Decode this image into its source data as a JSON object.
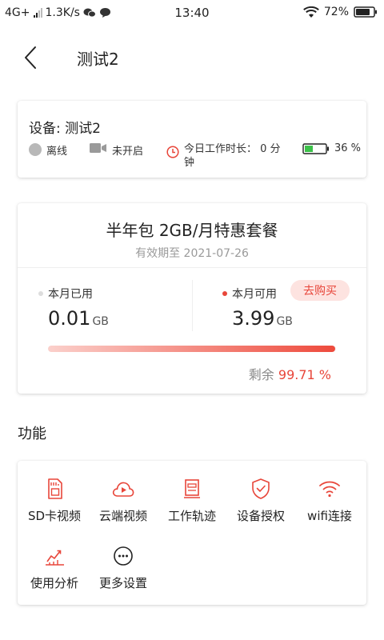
{
  "status_bar": {
    "network": "4G+",
    "speed": "1.3K/s",
    "time": "13:40",
    "battery": "72%"
  },
  "header": {
    "title": "测试2"
  },
  "device": {
    "name": "设备: 测试2",
    "status": "离线",
    "camera": "未开启",
    "work_time": "今日工作时长： 0 分钟",
    "battery": "36 %"
  },
  "plan": {
    "title": "半年包 2GB/月特惠套餐",
    "expiry": "有效期至 2021-07-26",
    "used_label": "本月已用",
    "used_value": "0.01",
    "used_unit": "GB",
    "avail_label": "本月可用",
    "avail_value": "3.99",
    "avail_unit": "GB",
    "buy_label": "去购买",
    "remaining_label": "剩余",
    "remaining_value": "99.71 %",
    "remaining_fraction": 0.9971
  },
  "features_title": "功能",
  "features": [
    {
      "label": "SD卡视频",
      "icon": "sd-card-icon"
    },
    {
      "label": "云端视频",
      "icon": "cloud-video-icon"
    },
    {
      "label": "工作轨迹",
      "icon": "track-icon"
    },
    {
      "label": "设备授权",
      "icon": "shield-check-icon"
    },
    {
      "label": "wifi连接",
      "icon": "wifi-icon"
    },
    {
      "label": "使用分析",
      "icon": "chart-icon"
    },
    {
      "label": "更多设置",
      "icon": "more-icon"
    }
  ],
  "colors": {
    "accent": "#e8463a",
    "battery_green": "#3cc24a",
    "offline_gray": "#b8b8b8"
  }
}
